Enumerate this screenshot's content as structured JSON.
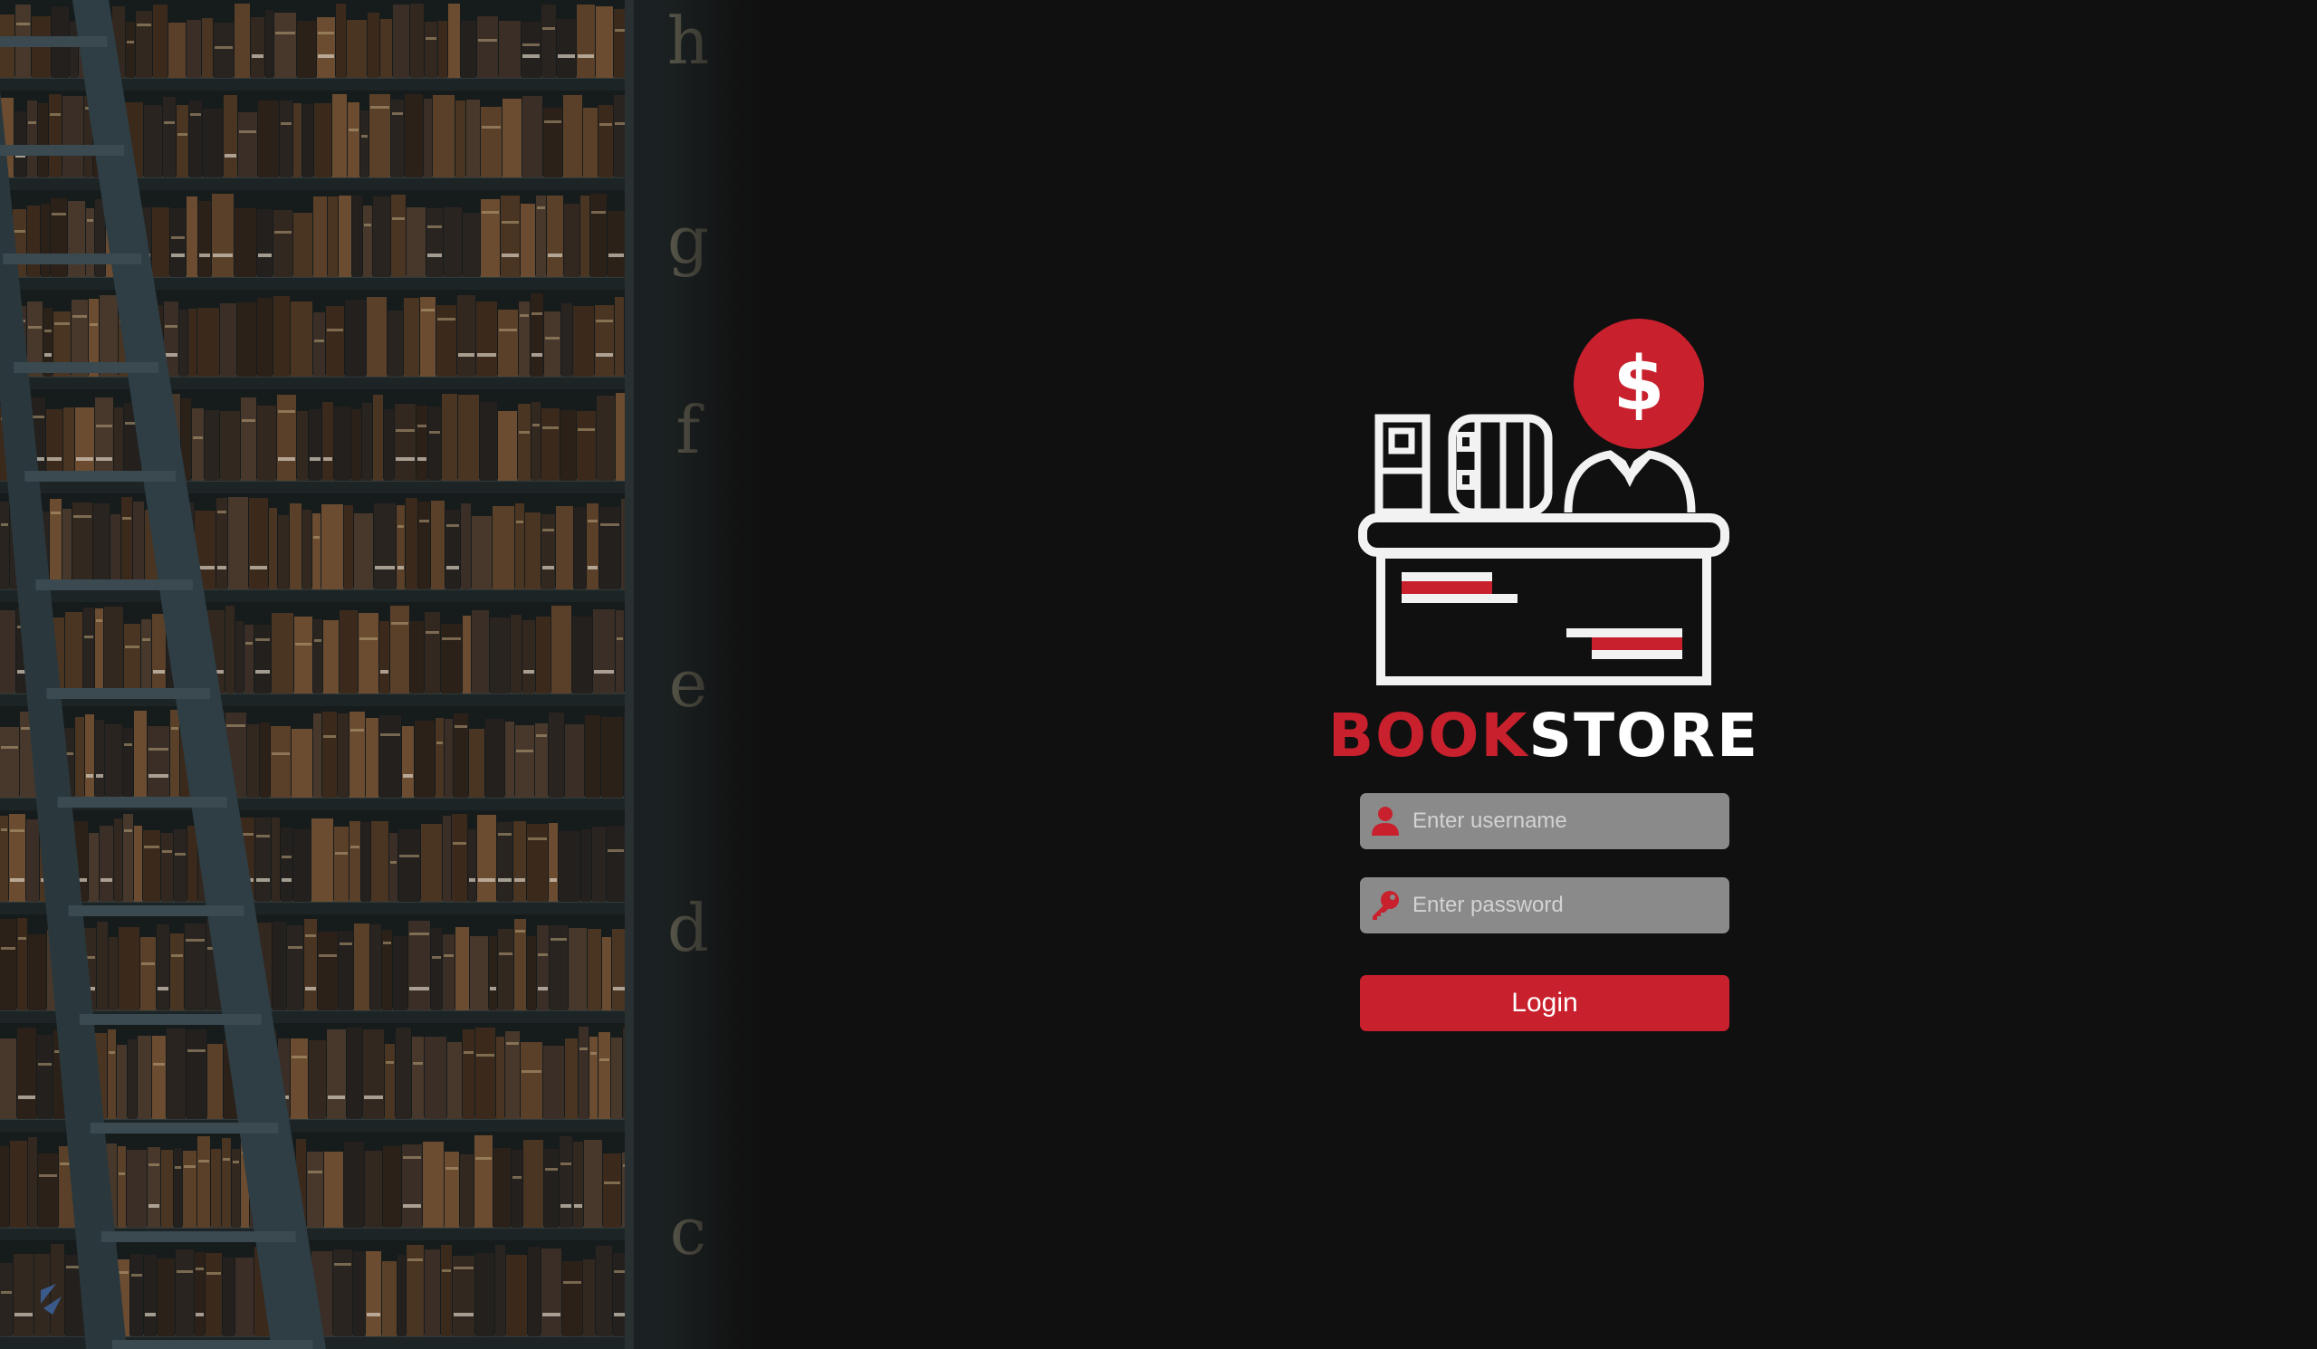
{
  "brand": {
    "part1": "BOOK",
    "part2": "STORE"
  },
  "photo": {
    "shelf_letters": [
      "h",
      "g",
      "f",
      "e",
      "d",
      "c"
    ]
  },
  "login_form": {
    "username": {
      "placeholder": "Enter username",
      "value": "",
      "icon": "user-icon"
    },
    "password": {
      "placeholder": "Enter password",
      "value": "",
      "icon": "key-icon"
    },
    "submit_label": "Login"
  },
  "logo": {
    "icon": "bookstore-cashier-logo",
    "badge_symbol": "$"
  },
  "colors": {
    "background": "#101010",
    "accent": "#c8202d",
    "field": "#8a8a8a",
    "logo_line": "#f2f2f2"
  }
}
